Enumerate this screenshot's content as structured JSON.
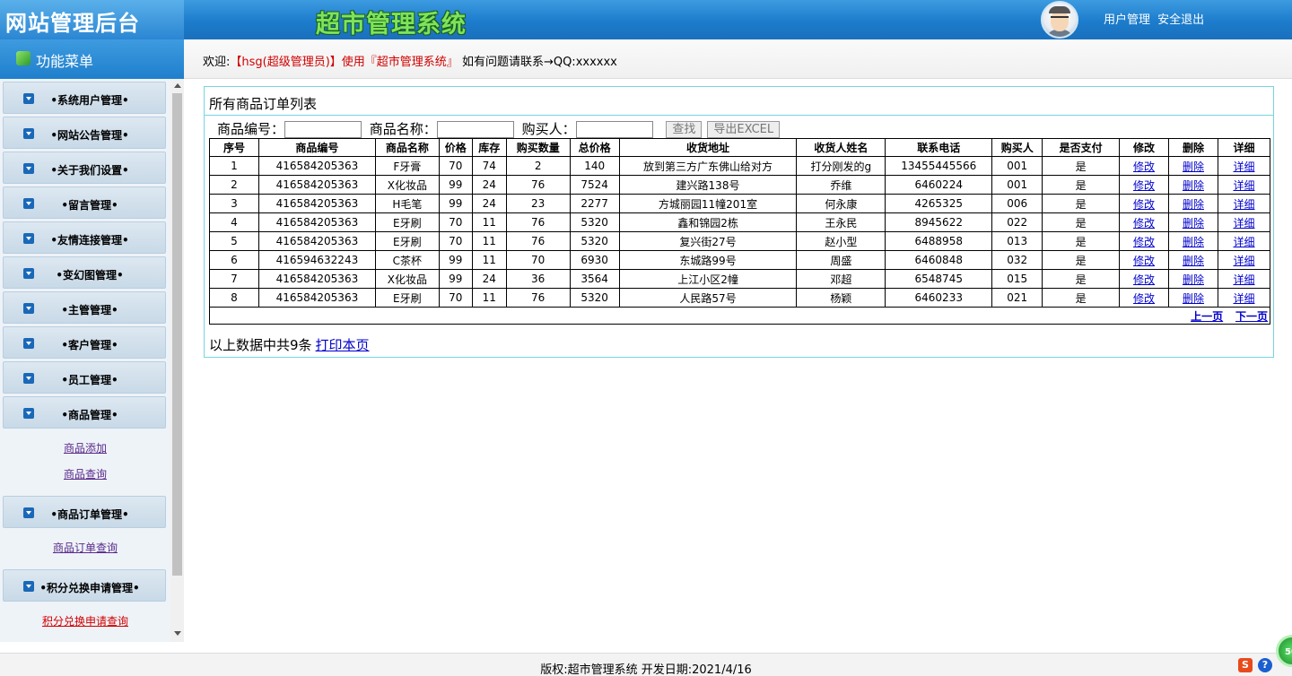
{
  "header": {
    "site_title": "网站管理后台",
    "system_title": "超市管理系统",
    "links": [
      "用户管理",
      "安全退出"
    ]
  },
  "sidebar": {
    "title": "功能菜单",
    "items": [
      {
        "label": "•系统用户管理•"
      },
      {
        "label": "•网站公告管理•"
      },
      {
        "label": "•关于我们设置•"
      },
      {
        "label": "•留言管理•"
      },
      {
        "label": "•友情连接管理•"
      },
      {
        "label": "•变幻图管理•"
      },
      {
        "label": "•主管管理•"
      },
      {
        "label": "•客户管理•"
      },
      {
        "label": "•员工管理•"
      },
      {
        "label": "•商品管理•",
        "sub": [
          "商品添加",
          "商品查询"
        ]
      },
      {
        "label": "•商品订单管理•",
        "sub": [
          "商品订单查询"
        ]
      },
      {
        "label": "•积分兑换申请管理•",
        "sub": [
          "积分兑换申请查询"
        ]
      }
    ]
  },
  "welcome": {
    "prefix": "欢迎:",
    "user": "【hsg(超级管理员)】使用『超市管理系统』",
    "suffix": "如有问题请联系→QQ:xxxxxx"
  },
  "panel": {
    "title": "所有商品订单列表",
    "search": {
      "code_label": "商品编号：",
      "name_label": "商品名称：",
      "buyer_label": "购买人：",
      "find_button": "查找",
      "export_button": "导出EXCEL"
    },
    "table": {
      "headers": [
        "序号",
        "商品编号",
        "商品名称",
        "价格",
        "库存",
        "购买数量",
        "总价格",
        "收货地址",
        "收货人姓名",
        "联系电话",
        "购买人",
        "是否支付",
        "修改",
        "删除",
        "详细"
      ],
      "rows": [
        [
          "1",
          "416584205363",
          "F牙膏",
          "70",
          "74",
          "2",
          "140",
          "放到第三方广东佛山给对方",
          "打分刚发的g",
          "13455445566",
          "001",
          "是"
        ],
        [
          "2",
          "416584205363",
          "X化妆品",
          "99",
          "24",
          "76",
          "7524",
          "建兴路138号",
          "乔维",
          "6460224",
          "001",
          "是"
        ],
        [
          "3",
          "416584205363",
          "H毛笔",
          "99",
          "24",
          "23",
          "2277",
          "方城丽园11幢201室",
          "何永康",
          "4265325",
          "006",
          "是"
        ],
        [
          "4",
          "416584205363",
          "E牙刷",
          "70",
          "11",
          "76",
          "5320",
          "鑫和锦园2栋",
          "王永民",
          "8945622",
          "022",
          "是"
        ],
        [
          "5",
          "416584205363",
          "E牙刷",
          "70",
          "11",
          "76",
          "5320",
          "复兴街27号",
          "赵小型",
          "6488958",
          "013",
          "是"
        ],
        [
          "6",
          "416594632243",
          "C茶杯",
          "99",
          "11",
          "70",
          "6930",
          "东城路99号",
          "周盛",
          "6460848",
          "032",
          "是"
        ],
        [
          "7",
          "416584205363",
          "X化妆品",
          "99",
          "24",
          "36",
          "3564",
          "上江小区2幢",
          "邓超",
          "6548745",
          "015",
          "是"
        ],
        [
          "8",
          "416584205363",
          "E牙刷",
          "70",
          "11",
          "76",
          "5320",
          "人民路57号",
          "杨颖",
          "6460233",
          "021",
          "是"
        ]
      ],
      "action_labels": {
        "edit": "修改",
        "delete": "删除",
        "detail": "详细"
      },
      "pager": {
        "prev": "上一页",
        "next": "下一页"
      }
    },
    "footer_text": "以上数据中共9条",
    "print_link": "打印本页"
  },
  "footer": {
    "text": "版权:超市管理系统 开发日期:2021/4/16"
  },
  "tray": {
    "badge": "50"
  }
}
